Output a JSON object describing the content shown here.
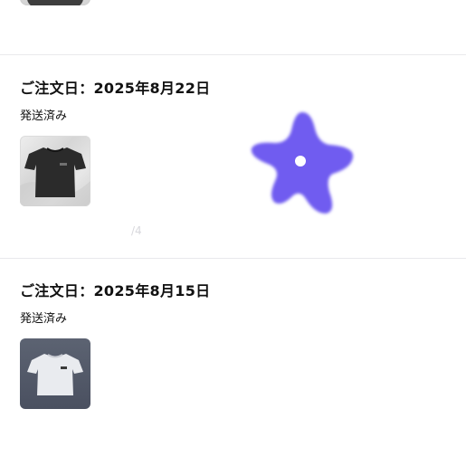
{
  "orders": [
    {
      "date": "ご注文日：2025年8月22日",
      "status": "発送済み",
      "product_image": "black-tshirt-thumbnail"
    },
    {
      "date": "ご注文日：2025年8月15日",
      "status": "発送済み",
      "product_image": "white-tshirt-thumbnail"
    }
  ],
  "overlay": {
    "icon": "purple-star-sticker",
    "color": "#6f5cf0"
  },
  "colors": {
    "divider": "#e9e9ec",
    "text": "#111111",
    "star": "#6f5cf0"
  }
}
